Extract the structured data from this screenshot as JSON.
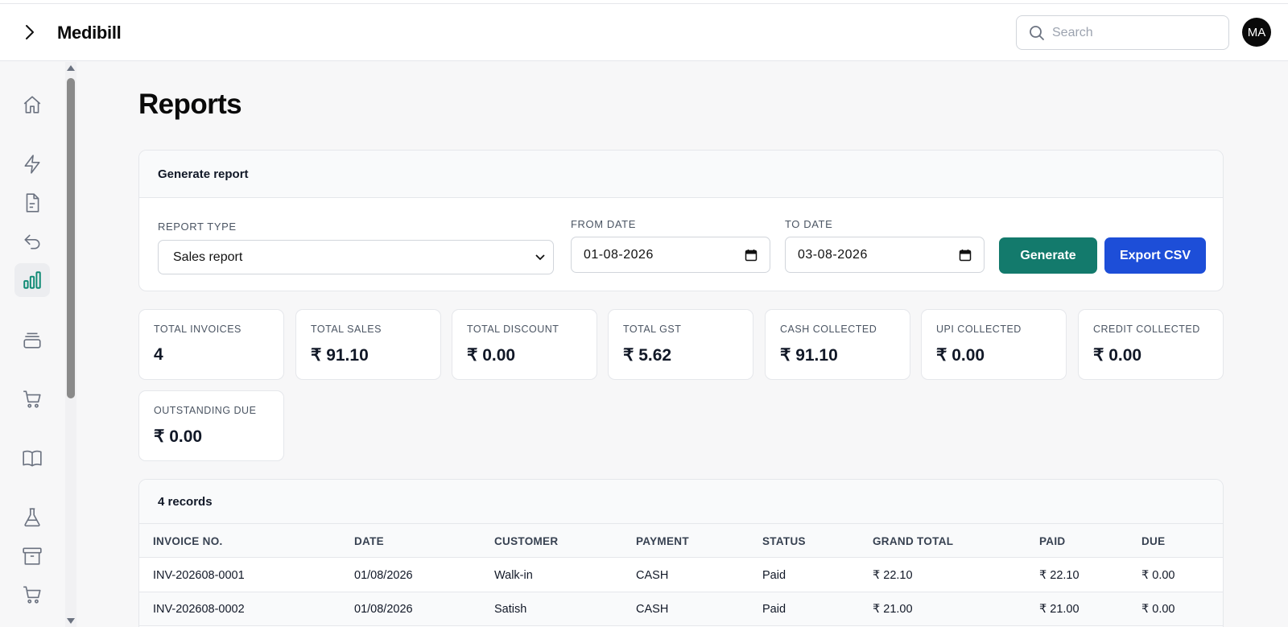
{
  "app": {
    "title": "Medibill"
  },
  "header": {
    "search_placeholder": "Search",
    "avatar_initials": "MA"
  },
  "sidebar": {
    "items": [
      {
        "icon": "home-icon",
        "active": false
      },
      {
        "icon": "bolt-icon",
        "active": false
      },
      {
        "icon": "document-icon",
        "active": false
      },
      {
        "icon": "return-icon",
        "active": false
      },
      {
        "icon": "bar-chart-icon",
        "active": true
      },
      {
        "icon": "archive-box-icon",
        "active": false
      },
      {
        "icon": "cart-icon",
        "active": false
      },
      {
        "icon": "book-icon",
        "active": false
      },
      {
        "icon": "flask-icon",
        "active": false
      },
      {
        "icon": "archive-icon",
        "active": false
      },
      {
        "icon": "cart-icon",
        "active": false
      }
    ]
  },
  "page": {
    "title": "Reports"
  },
  "generate": {
    "heading": "Generate report",
    "report_type_label": "REPORT TYPE",
    "report_type_value": "Sales report",
    "from_label": "FROM DATE",
    "from_value": "01-08-2026",
    "to_label": "TO DATE",
    "to_value": "03-08-2026",
    "generate_btn": "Generate",
    "export_btn": "Export CSV"
  },
  "stats": [
    {
      "label": "TOTAL INVOICES",
      "value": "4"
    },
    {
      "label": "TOTAL SALES",
      "value": "₹ 91.10"
    },
    {
      "label": "TOTAL DISCOUNT",
      "value": "₹ 0.00"
    },
    {
      "label": "TOTAL GST",
      "value": "₹ 5.62"
    },
    {
      "label": "CASH COLLECTED",
      "value": "₹ 91.10"
    },
    {
      "label": "UPI COLLECTED",
      "value": "₹ 0.00"
    },
    {
      "label": "CREDIT COLLECTED",
      "value": "₹ 0.00"
    },
    {
      "label": "OUTSTANDING DUE",
      "value": "₹ 0.00"
    }
  ],
  "table": {
    "records_label": "4 records",
    "columns": [
      "INVOICE NO.",
      "DATE",
      "CUSTOMER",
      "PAYMENT",
      "STATUS",
      "GRAND TOTAL",
      "PAID",
      "DUE"
    ],
    "rows": [
      [
        "INV-202608-0001",
        "01/08/2026",
        "Walk-in",
        "CASH",
        "Paid",
        "₹ 22.10",
        "₹ 22.10",
        "₹ 0.00"
      ],
      [
        "INV-202608-0002",
        "01/08/2026",
        "Satish",
        "CASH",
        "Paid",
        "₹ 21.00",
        "₹ 21.00",
        "₹ 0.00"
      ]
    ]
  },
  "colors": {
    "primary_green": "#137a6c",
    "primary_blue": "#1d4ed8",
    "active_icon": "#0f8a74"
  }
}
